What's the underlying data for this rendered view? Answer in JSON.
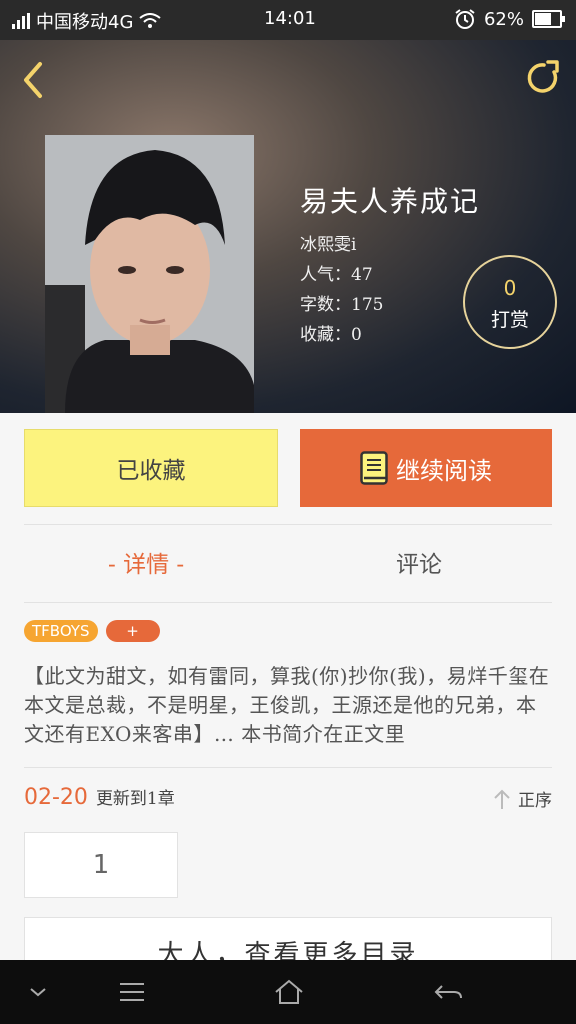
{
  "status_bar": {
    "carrier": "中国移动4G",
    "time": "14:01",
    "battery": "62%",
    "battery_level": 0.62
  },
  "book": {
    "title": "易夫人养成记",
    "author": "冰熙雯i",
    "popularity": "人气：47",
    "word_count": "字数：175",
    "favorites": "收藏：0",
    "reward_count": "0",
    "reward_label": "打赏"
  },
  "actions": {
    "favorited_label": "已收藏",
    "continue_label": "继续阅读"
  },
  "tabs": {
    "detail": "- 详情 -",
    "comment": "评论"
  },
  "tags": [
    "TFBOYS",
    "+"
  ],
  "description": "【此文为甜文，如有雷同，算我(你)抄你(我)，易烊千玺在本文是总裁，不是明星，王俊凯，王源还是他的兄弟，本文还有EXO来客串】… 本书简介在正文里",
  "update": {
    "date": "02-20",
    "text": "更新到1章",
    "order_label": "正序"
  },
  "chapter_page": "1",
  "more_catalog": "大人，查看更多目录",
  "colors": {
    "accent": "#e6693a",
    "favorite_button": "#fcf37e",
    "tag_yellow": "#f6a531"
  }
}
